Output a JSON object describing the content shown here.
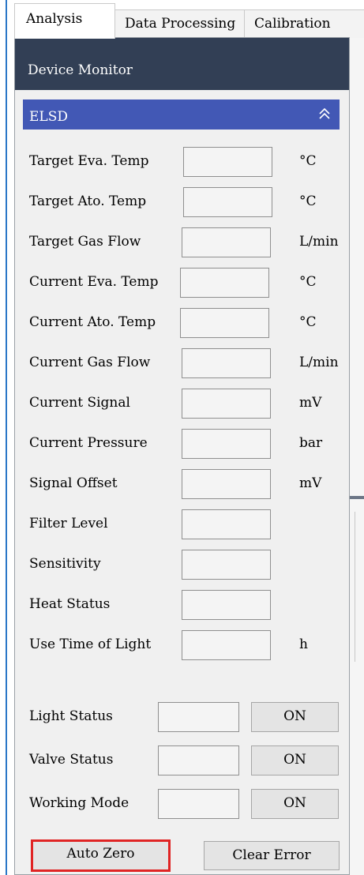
{
  "tabs": [
    {
      "label": "Analysis",
      "active": true
    },
    {
      "label": "Data Processing",
      "active": false
    },
    {
      "label": "Calibration",
      "active": false
    }
  ],
  "panel": {
    "title": "Device Monitor",
    "section": {
      "title": "ELSD",
      "collapse_icon": "chevron-double-up-icon"
    },
    "rows": [
      {
        "label": "Target Eva. Temp",
        "value": "",
        "unit": "°C"
      },
      {
        "label": "Target Ato. Temp",
        "value": "",
        "unit": "°C"
      },
      {
        "label": "Target Gas Flow",
        "value": "",
        "unit": "L/min"
      },
      {
        "label": "Current Eva. Temp",
        "value": "",
        "unit": "°C"
      },
      {
        "label": "Current Ato. Temp",
        "value": "",
        "unit": "°C"
      },
      {
        "label": "Current Gas Flow",
        "value": "",
        "unit": "L/min"
      },
      {
        "label": "Current Signal",
        "value": "",
        "unit": "mV"
      },
      {
        "label": "Current Pressure",
        "value": "",
        "unit": "bar"
      },
      {
        "label": "Signal Offset",
        "value": "",
        "unit": "mV"
      },
      {
        "label": "Filter Level",
        "value": "",
        "unit": ""
      },
      {
        "label": "Sensitivity",
        "value": "",
        "unit": ""
      },
      {
        "label": "Heat Status",
        "value": "",
        "unit": ""
      },
      {
        "label": "Use Time of Light",
        "value": "",
        "unit": "h"
      }
    ],
    "toggles": [
      {
        "label": "Light Status",
        "value": "",
        "button": "ON"
      },
      {
        "label": "Valve Status",
        "value": "",
        "button": "ON"
      },
      {
        "label": "Working Mode",
        "value": "",
        "button": "ON"
      }
    ],
    "actions": {
      "auto_zero": "Auto Zero",
      "clear_error": "Clear Error"
    },
    "colors": {
      "header_bg": "#323f55",
      "section_bg": "#4258b5",
      "highlight": "#e02424"
    }
  }
}
